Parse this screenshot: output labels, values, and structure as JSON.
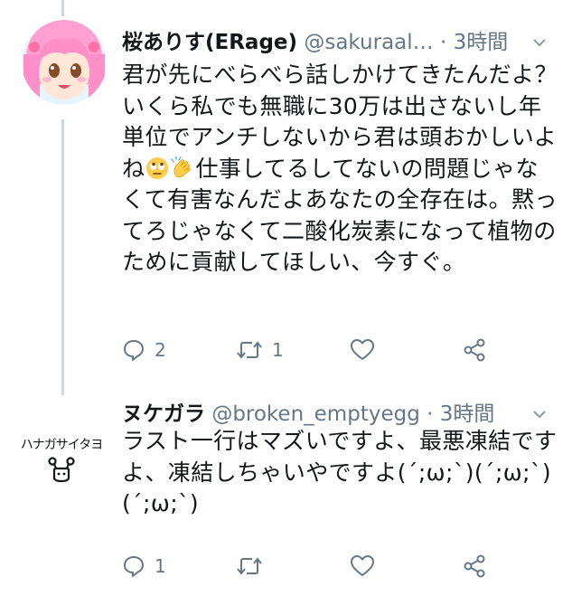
{
  "tweets": [
    {
      "name": "桜ありす(ERage)",
      "handle": "@sakuraal…",
      "separator": "·",
      "time": "3時間",
      "body_before_emoji": "君が先にべらべら話しかけてきたんだよ？いくら私でも無職に30万は出さないし年単位でアンチしないから君は頭おかしいよね",
      "body_after_emoji": "仕事してるしてないの問題じゃなくて有害なんだよあなたの全存在は。黙ってろじゃなくて二酸化炭素になって植物のために貢献してほしい、今すぐ。",
      "emojis": [
        "rolling-eyes-emoji",
        "clapping-hands-emoji"
      ],
      "reply_count": "2",
      "retweet_count": "1",
      "like_count": "",
      "accent": "#ff8fc8"
    },
    {
      "name": "ヌケガラ",
      "handle": "@broken_emptyegg",
      "separator": "·",
      "time": "3時間",
      "avatar_text": "ハナガサイタヨ",
      "body": "ラスト一行はマズいですよ、最悪凍結ですよ、凍結しちゃいやですよ(´;ω;`)(´;ω;`)(´;ω;`)",
      "reply_count": "1",
      "retweet_count": "",
      "like_count": ""
    }
  ],
  "colors": {
    "text": "#14171a",
    "secondary": "#657786",
    "thread_line": "#ccd6dd"
  }
}
